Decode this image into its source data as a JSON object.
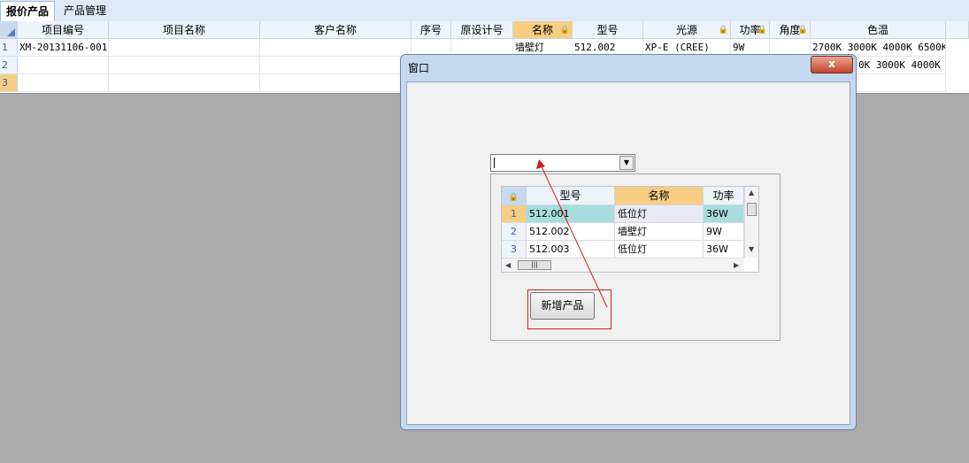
{
  "tabs": [
    {
      "label": "报价产品",
      "active": true
    },
    {
      "label": "产品管理",
      "active": false
    }
  ],
  "grid": {
    "columns": [
      "项目编号",
      "项目名称",
      "客户名称",
      "序号",
      "原设计号",
      "名称",
      "型号",
      "光源",
      "功率",
      "角度",
      "色温"
    ],
    "rows": [
      {
        "num": "1",
        "cells": [
          "XM-20131106-001",
          "",
          "",
          "",
          "",
          "墙壁灯",
          "512.002",
          "XP-E (CREE)",
          "9W",
          "",
          "2700K 3000K 4000K 6500K"
        ]
      },
      {
        "num": "2",
        "cells": [
          "",
          "",
          "",
          "",
          "",
          "",
          "",
          "",
          "",
          "",
          "0K 3000K 4000K 6500K"
        ]
      },
      {
        "num": "3",
        "cells": [
          "",
          "",
          "",
          "",
          "",
          "",
          "",
          "",
          "",
          "",
          ""
        ]
      }
    ]
  },
  "dialog": {
    "title": "窗口",
    "close_label": "x",
    "combo_value": "",
    "subgrid": {
      "columns": [
        "型号",
        "名称",
        "功率"
      ],
      "rows": [
        {
          "num": "1",
          "cells": [
            "512.001",
            "低位灯",
            "36W"
          ]
        },
        {
          "num": "2",
          "cells": [
            "512.002",
            "墙壁灯",
            "9W"
          ]
        },
        {
          "num": "3",
          "cells": [
            "512.003",
            "低位灯",
            "36W"
          ]
        }
      ]
    },
    "add_button_label": "新增产品"
  },
  "colors": {
    "annotation": "#d21e1e",
    "selected_header": "#f6cd82",
    "highlight_cell": "#a8dcdf"
  }
}
